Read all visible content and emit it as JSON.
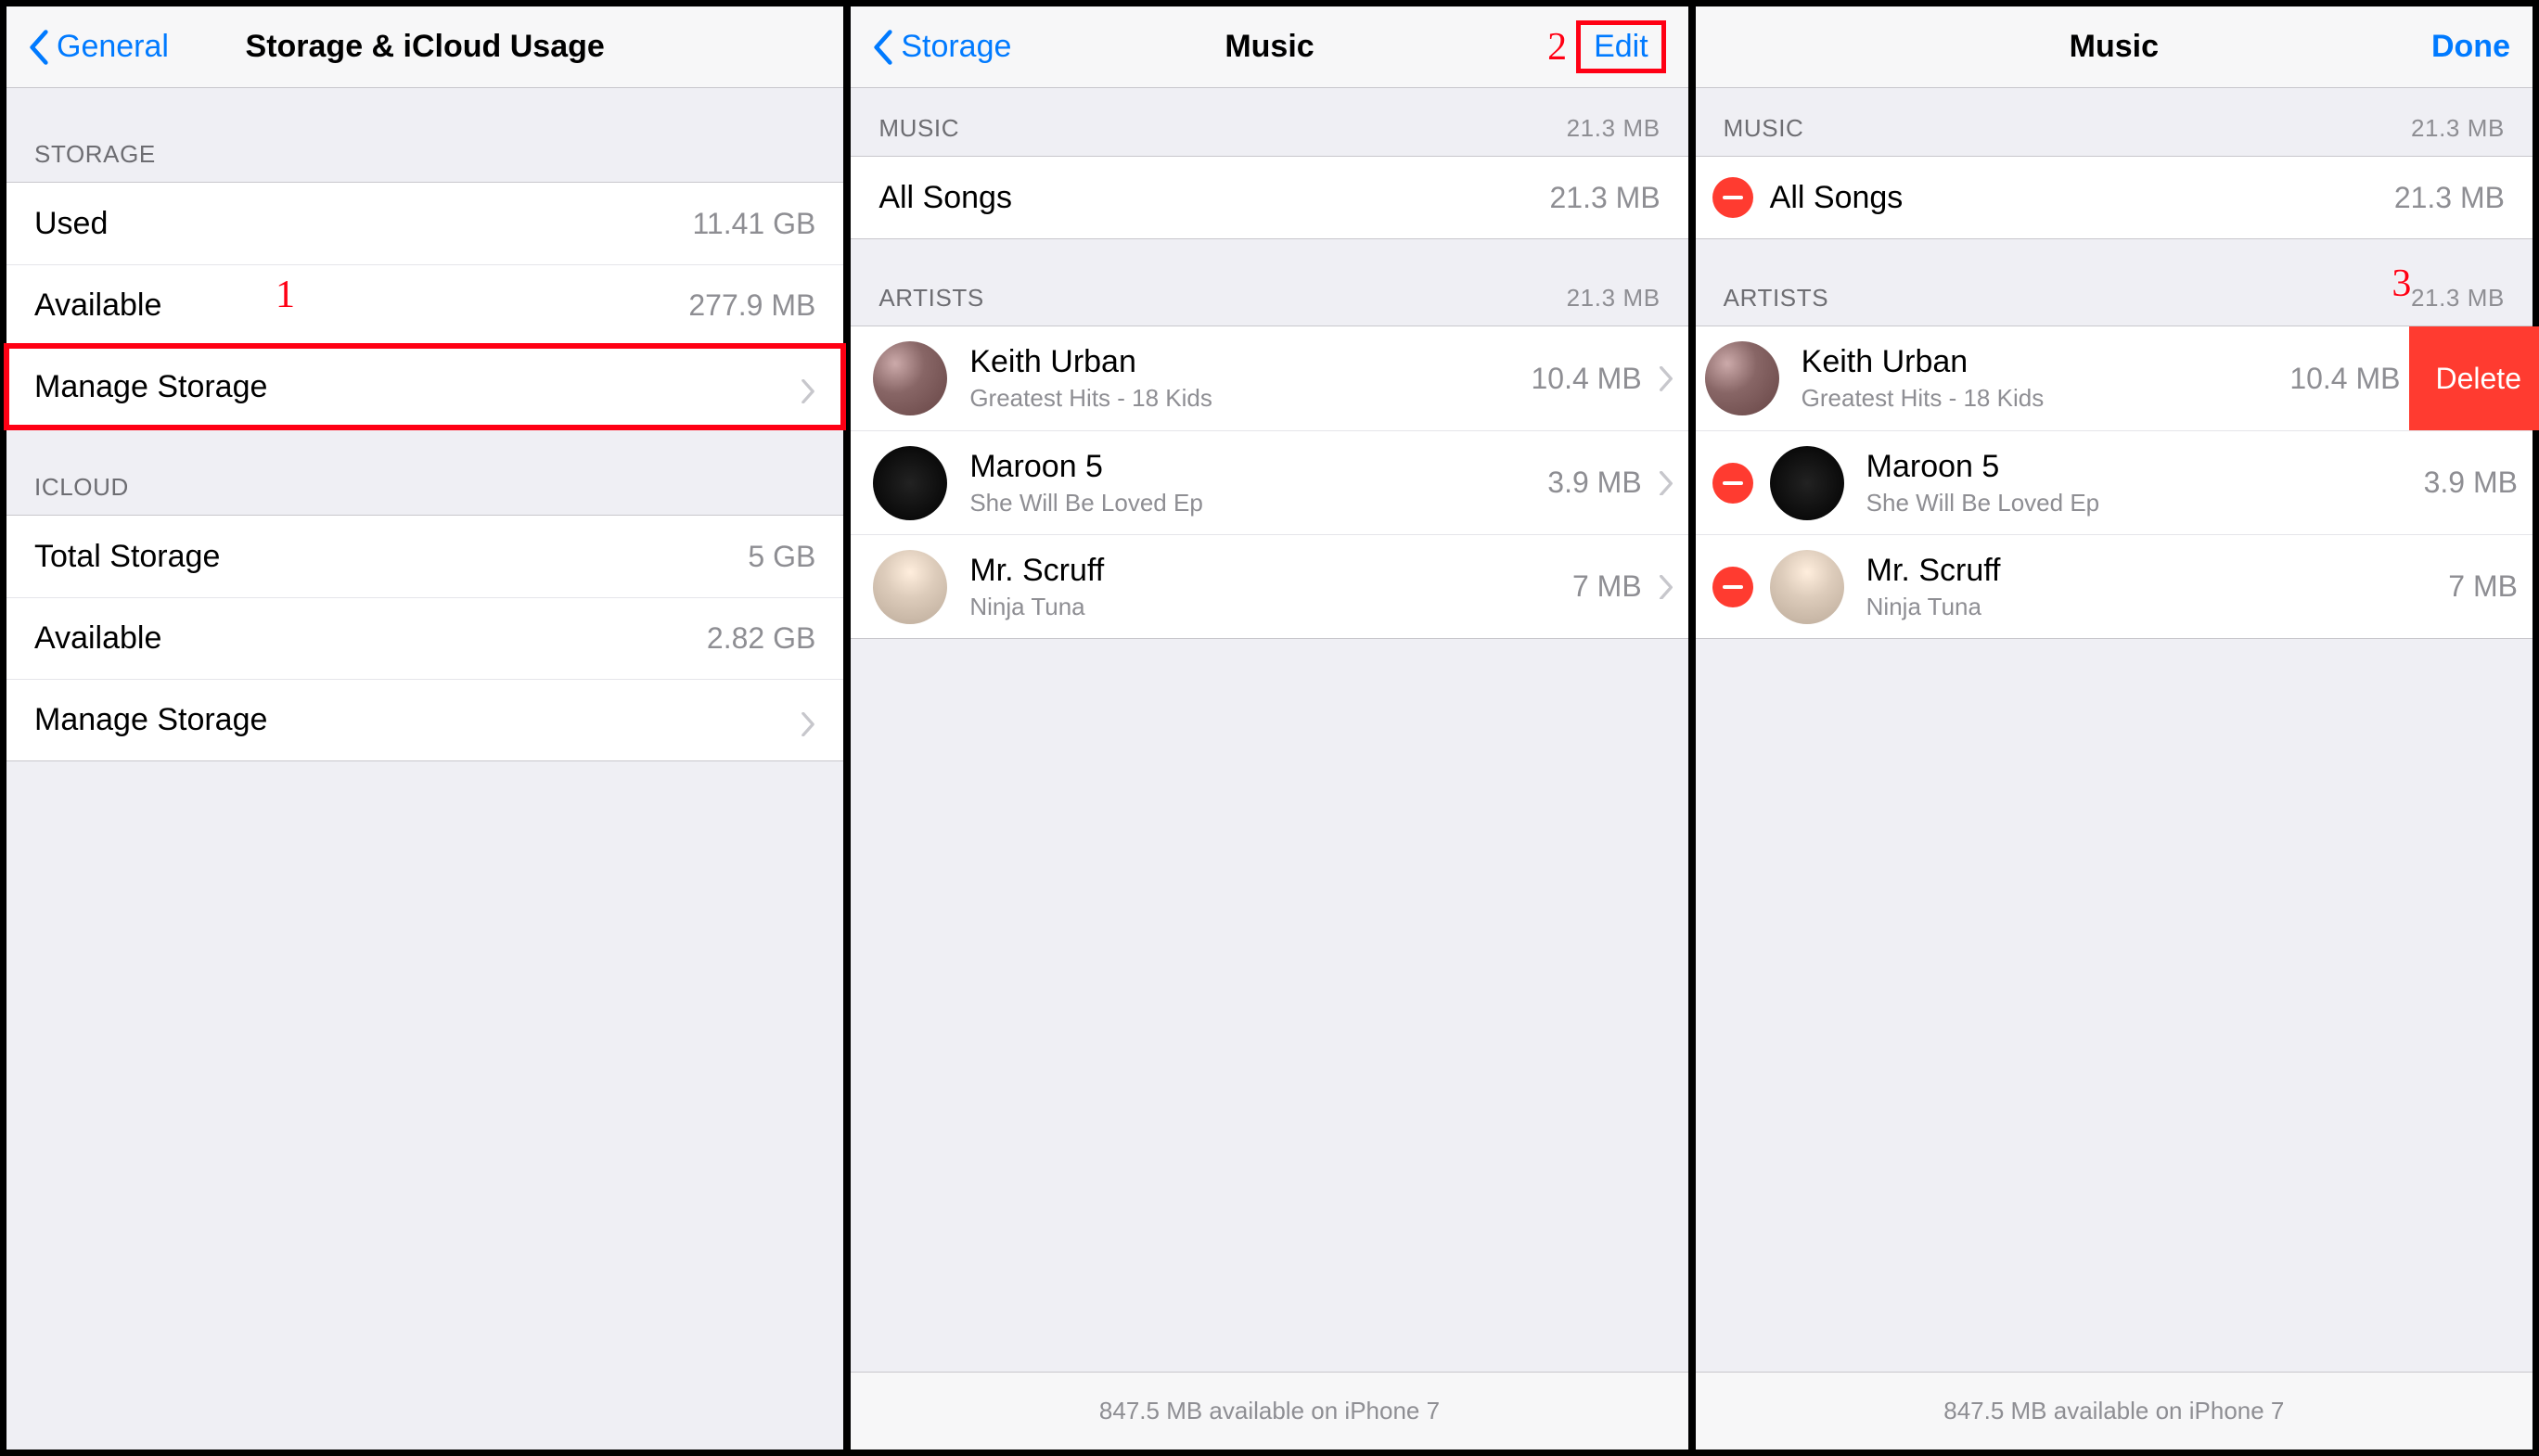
{
  "annotations": {
    "one": "1",
    "two": "2",
    "three": "3"
  },
  "panel1": {
    "back_label": "General",
    "title": "Storage & iCloud Usage",
    "sections": {
      "storage": {
        "header": "STORAGE",
        "rows": {
          "used": {
            "label": "Used",
            "value": "11.41 GB"
          },
          "available": {
            "label": "Available",
            "value": "277.9 MB"
          },
          "manage": {
            "label": "Manage Storage"
          }
        }
      },
      "icloud": {
        "header": "ICLOUD",
        "rows": {
          "total": {
            "label": "Total Storage",
            "value": "5 GB"
          },
          "available": {
            "label": "Available",
            "value": "2.82 GB"
          },
          "manage": {
            "label": "Manage Storage"
          }
        }
      }
    }
  },
  "panel2": {
    "back_label": "Storage",
    "title": "Music",
    "edit_label": "Edit",
    "music_header": "MUSIC",
    "music_size": "21.3 MB",
    "all_songs": {
      "label": "All Songs",
      "size": "21.3 MB"
    },
    "artists_header": "ARTISTS",
    "artists_size": "21.3 MB",
    "artists": [
      {
        "name": "Keith Urban",
        "sub": "Greatest Hits - 18 Kids",
        "size": "10.4 MB"
      },
      {
        "name": "Maroon 5",
        "sub": "She Will Be Loved Ep",
        "size": "3.9 MB"
      },
      {
        "name": "Mr. Scruff",
        "sub": "Ninja Tuna",
        "size": "7 MB"
      }
    ],
    "footer": "847.5 MB available on iPhone 7"
  },
  "panel3": {
    "title": "Music",
    "done_label": "Done",
    "music_header": "MUSIC",
    "music_size": "21.3 MB",
    "all_songs": {
      "label": "All Songs",
      "size": "21.3 MB"
    },
    "artists_header": "ARTISTS",
    "artists_size": "21.3 MB",
    "delete_label": "Delete",
    "artists": [
      {
        "name": "Keith Urban",
        "sub": "Greatest Hits - 18 Kids",
        "size": "10.4 MB"
      },
      {
        "name": "Maroon 5",
        "sub": "She Will Be Loved Ep",
        "size": "3.9 MB"
      },
      {
        "name": "Mr. Scruff",
        "sub": "Ninja Tuna",
        "size": "7 MB"
      }
    ],
    "footer": "847.5 MB available on iPhone 7"
  }
}
